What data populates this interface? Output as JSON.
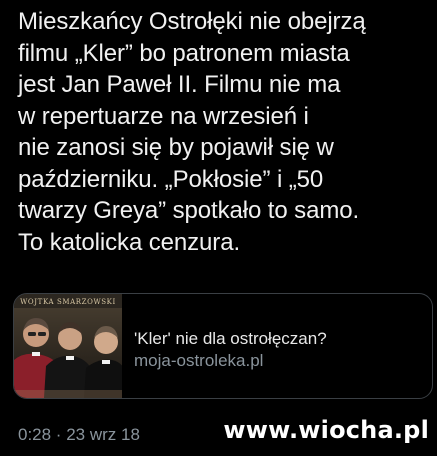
{
  "tweet": {
    "lines": [
      "Mieszkańcy Ostrołęki nie obejrzą",
      "filmu „Kler” bo patronem miasta",
      "jest Jan Paweł II. Filmu nie ma",
      "w repertuarze na wrzesień i",
      "nie zanosi się by pojawił się w",
      "październiku. „Pokłosie” i „50",
      "twarzy Greya” spotkało to samo.",
      "To katolicka cenzura."
    ]
  },
  "link_card": {
    "poster_text": "WOJTKA SMARZOWSKI",
    "title": "'Kler' nie dla ostrołęczan?",
    "domain": "moja-ostroleka.pl"
  },
  "meta": {
    "timestamp": "0:28 · 23 wrz 18"
  },
  "watermark": {
    "text": "www.wiocha.pl"
  },
  "colors": {
    "background": "#000000",
    "text": "#f1f1f1",
    "muted": "#8a949c",
    "card_border": "#3a3f44"
  }
}
